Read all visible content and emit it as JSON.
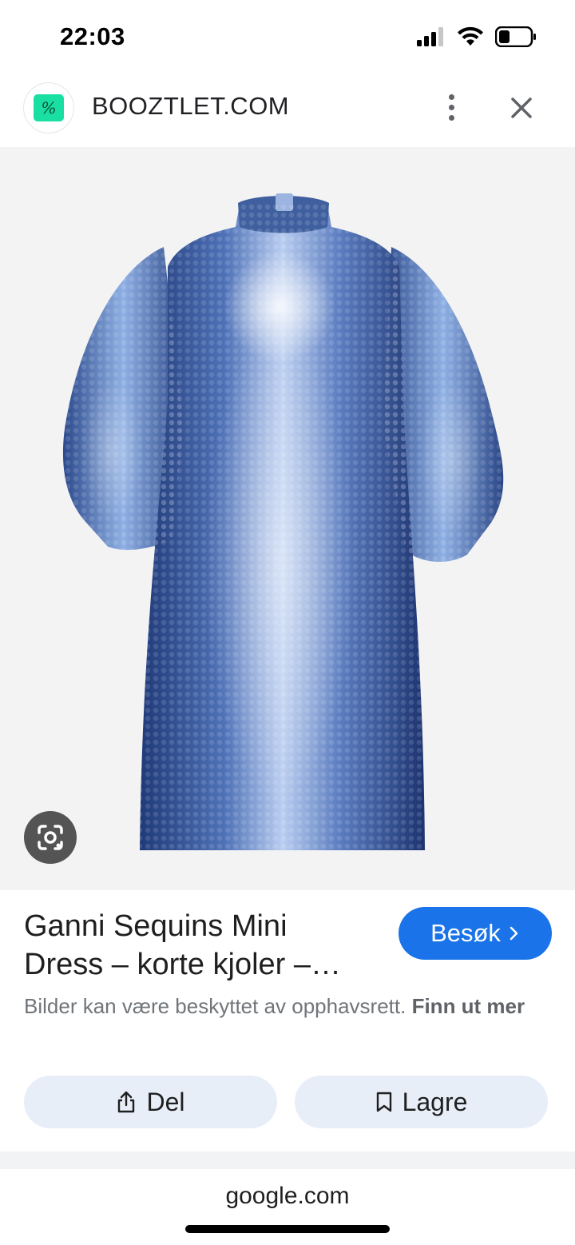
{
  "status_bar": {
    "time": "22:03",
    "icons": [
      "signal-icon",
      "wifi-icon",
      "battery-icon"
    ]
  },
  "header": {
    "site_name": "BOOZTLET.COM",
    "logo_glyph": "%",
    "logo_color": "#19e0a2",
    "more_icon": "more-vert-icon",
    "close_icon": "close-icon"
  },
  "image": {
    "subject": "sequin-dress",
    "dress_color": "#3f5f9f",
    "lens_icon": "google-lens-icon"
  },
  "result": {
    "title_line1": "Ganni Sequins Mini",
    "title_line2": "Dress – korte kjoler –…",
    "visit_label": "Besøk",
    "visit_icon": "chevron-right-icon",
    "copyright_text": "Bilder kan være beskyttet av opphavsrett. ",
    "learn_more": "Finn ut mer"
  },
  "actions": {
    "share_label": "Del",
    "share_icon": "share-icon",
    "save_label": "Lagre",
    "save_icon": "bookmark-icon"
  },
  "footer": {
    "url": "google.com"
  },
  "colors": {
    "accent": "#1a73e8",
    "chip_bg": "#e8eef8"
  }
}
